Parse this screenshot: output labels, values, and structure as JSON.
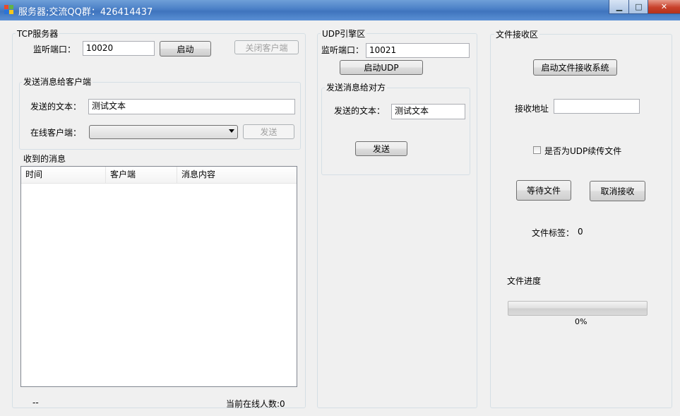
{
  "window": {
    "title": "服务器;交流QQ群：426414437",
    "controls": {
      "minimize": "▁",
      "maximize": "□",
      "close": "✕"
    }
  },
  "tcp": {
    "group_title": "TCP服务器",
    "port_label": "监听端口：",
    "port_value": "10020",
    "start_button": "启动",
    "close_client_button": "关闭客户端",
    "send_group_title": "发送消息给客户端",
    "send_text_label": "发送的文本：",
    "send_text_value": "测试文本",
    "online_client_label": "在线客户端：",
    "online_client_value": "",
    "send_button": "发送",
    "received_group_title": "收到的消息",
    "columns": [
      "时间",
      "客户端",
      "消息内容"
    ],
    "rows": [],
    "status_left": "--",
    "online_count_text": "当前在线人数:0"
  },
  "udp": {
    "group_title": "UDP引擎区",
    "port_label": "监听端口：",
    "port_value": "10021",
    "start_button": "启动UDP",
    "send_group_title": "发送消息给对方",
    "send_text_label": "发送的文本：",
    "send_text_value": "测试文本",
    "send_button": "发送"
  },
  "file": {
    "group_title": "文件接收区",
    "start_system_button": "启动文件接收系统",
    "address_label": "接收地址",
    "address_value": "",
    "udp_resume_label": "是否为UDP续传文件",
    "udp_resume_checked": false,
    "wait_button": "等待文件",
    "cancel_button": "取消接收",
    "tag_label": "文件标签：",
    "tag_value": "0",
    "progress_label": "文件进度",
    "progress_percent": 0,
    "progress_text": "0%"
  },
  "colors": {
    "titlebar": "#4a7fc6",
    "close_button": "#c8412b",
    "progress_fill": "#37d837",
    "group_border": "#d5dfe5"
  },
  "icons": {
    "app": "windows-app-icon",
    "combo": "chevron-down-icon"
  }
}
